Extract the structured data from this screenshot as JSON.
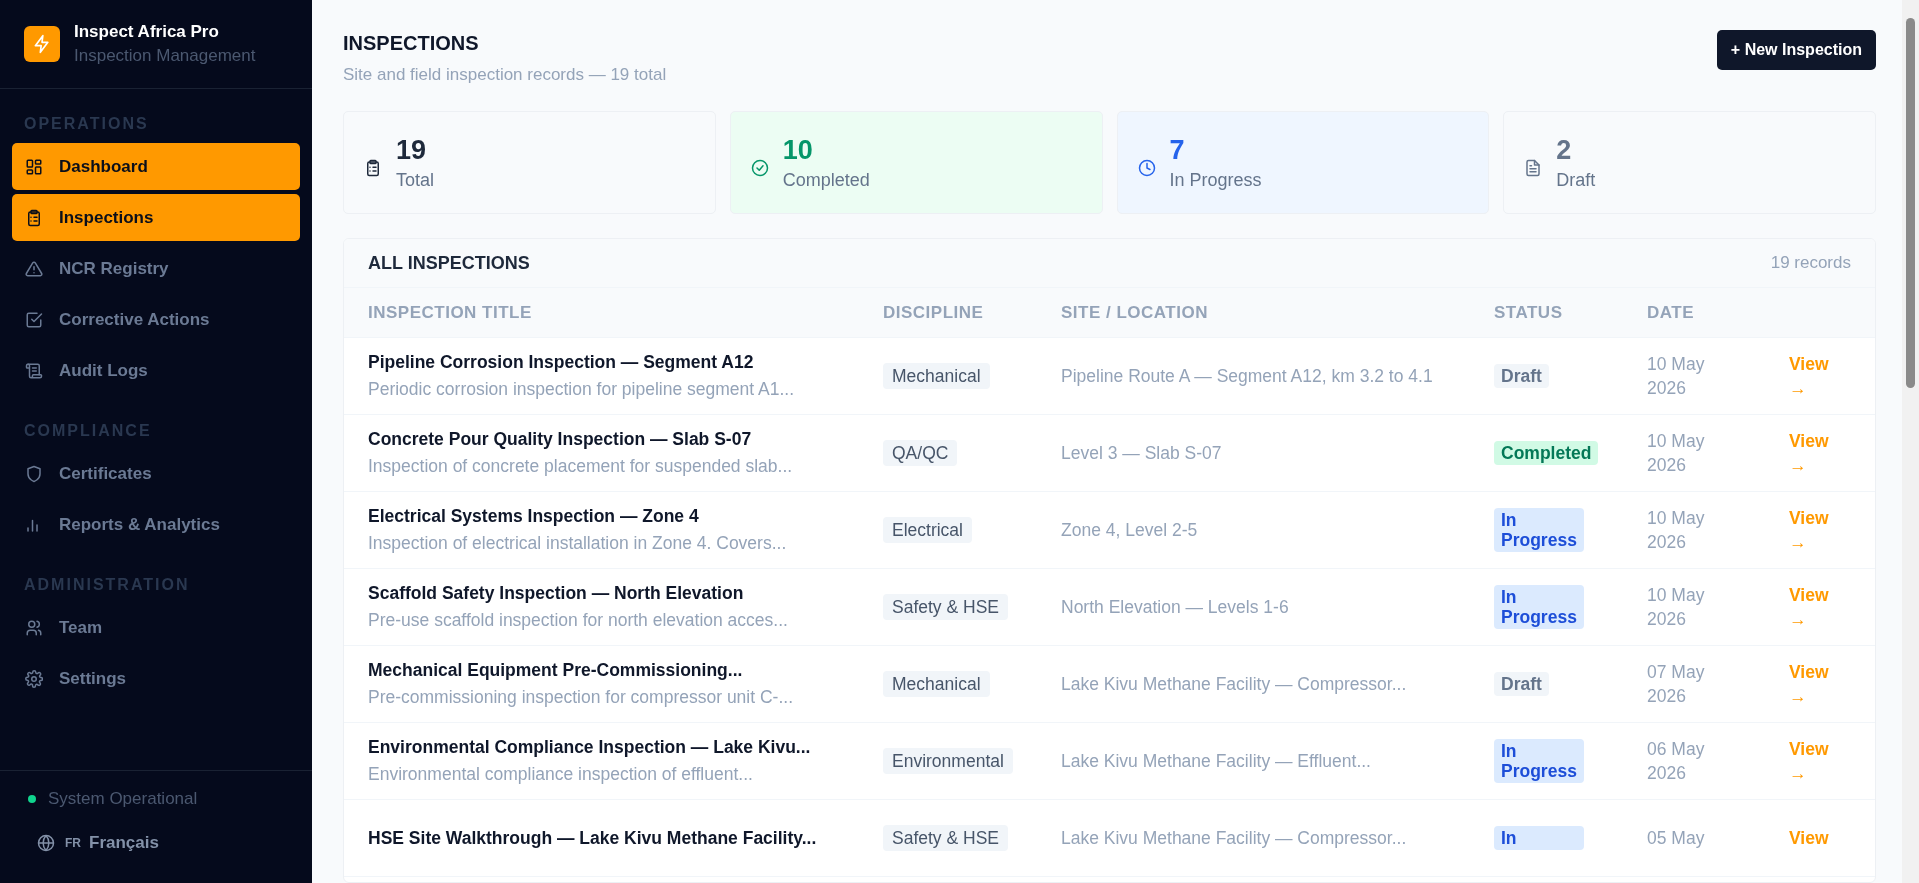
{
  "sidebar": {
    "brand": {
      "name": "Inspect Africa Pro",
      "subtitle": "Inspection Management"
    },
    "sections": [
      {
        "heading": "OPERATIONS",
        "items": [
          {
            "label": "Dashboard",
            "kind": "dashboard",
            "selected": true
          },
          {
            "label": "Inspections",
            "kind": "inspections",
            "selected": true
          },
          {
            "label": "NCR Registry",
            "kind": "ncr",
            "selected": false
          },
          {
            "label": "Corrective Actions",
            "kind": "actions",
            "selected": false
          },
          {
            "label": "Audit Logs",
            "kind": "audit",
            "selected": false
          }
        ]
      },
      {
        "heading": "COMPLIANCE",
        "items": [
          {
            "label": "Certificates",
            "kind": "certificates",
            "selected": false
          },
          {
            "label": "Reports & Analytics",
            "kind": "reports",
            "selected": false
          }
        ]
      },
      {
        "heading": "ADMINISTRATION",
        "items": [
          {
            "label": "Team",
            "kind": "team",
            "selected": false
          },
          {
            "label": "Settings",
            "kind": "settings",
            "selected": false
          }
        ]
      }
    ],
    "system_status": "System Operational",
    "language": {
      "code": "FR",
      "label": "Français"
    }
  },
  "page": {
    "title": "INSPECTIONS",
    "subtitle": "Site and field inspection records — 19 total",
    "new_button": "+ New Inspection"
  },
  "stats": [
    {
      "value": "19",
      "label": "Total",
      "kind": "total"
    },
    {
      "value": "10",
      "label": "Completed",
      "kind": "completed"
    },
    {
      "value": "7",
      "label": "In Progress",
      "kind": "in_progress"
    },
    {
      "value": "2",
      "label": "Draft",
      "kind": "draft"
    }
  ],
  "table": {
    "title": "ALL INSPECTIONS",
    "count": "19 records",
    "columns": [
      "INSPECTION TITLE",
      "DISCIPLINE",
      "SITE / LOCATION",
      "STATUS",
      "DATE"
    ],
    "rows": [
      {
        "title": "Pipeline Corrosion Inspection — Segment A12",
        "description": "Periodic corrosion inspection for pipeline segment A1...",
        "discipline": "Mechanical",
        "site": "Pipeline Route A — Segment A12, km 3.2 to 4.1",
        "status": {
          "label": "Draft",
          "kind": "draft"
        },
        "date": "10 May 2026",
        "action": "View →"
      },
      {
        "title": "Concrete Pour Quality Inspection — Slab S-07",
        "description": "Inspection of concrete placement for suspended slab...",
        "discipline": "QA/QC",
        "site": "Level 3 — Slab S-07",
        "status": {
          "label": "Completed",
          "kind": "completed"
        },
        "date": "10 May 2026",
        "action": "View →"
      },
      {
        "title": "Electrical Systems Inspection — Zone 4",
        "description": "Inspection of electrical installation in Zone 4. Covers...",
        "discipline": "Electrical",
        "site": "Zone 4, Level 2-5",
        "status": {
          "label": "In Progress",
          "kind": "in_progress"
        },
        "date": "10 May 2026",
        "action": "View →"
      },
      {
        "title": "Scaffold Safety Inspection — North Elevation",
        "description": "Pre-use scaffold inspection for north elevation acces...",
        "discipline": "Safety & HSE",
        "site": "North Elevation — Levels 1-6",
        "status": {
          "label": "In Progress",
          "kind": "in_progress"
        },
        "date": "10 May 2026",
        "action": "View →"
      },
      {
        "title": "Mechanical Equipment Pre-Commissioning...",
        "description": "Pre-commissioning inspection for compressor unit C-...",
        "discipline": "Mechanical",
        "site": "Lake Kivu Methane Facility — Compressor...",
        "status": {
          "label": "Draft",
          "kind": "draft"
        },
        "date": "07 May 2026",
        "action": "View →"
      },
      {
        "title": "Environmental Compliance Inspection — Lake Kivu...",
        "description": "Environmental compliance inspection of effluent...",
        "discipline": "Environmental",
        "site": "Lake Kivu Methane Facility — Effluent...",
        "status": {
          "label": "In Progress",
          "kind": "in_progress"
        },
        "date": "06 May 2026",
        "action": "View →"
      },
      {
        "title": "HSE Site Walkthrough — Lake Kivu Methane Facility...",
        "discipline": "Safety & HSE",
        "site": "Lake Kivu Methane Facility — Compressor...",
        "status": {
          "label": "In",
          "kind": "in_progress"
        },
        "date": "05 May",
        "action": "View"
      }
    ]
  }
}
